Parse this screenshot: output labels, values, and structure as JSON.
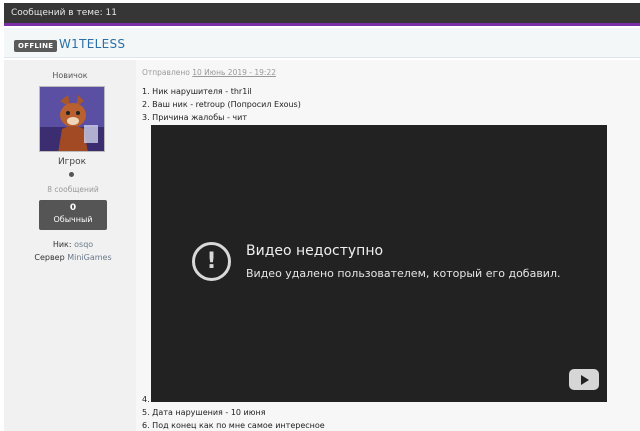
{
  "topbar": {
    "posts_in_topic": "Сообщений в теме: 11"
  },
  "post": {
    "status_badge": "OFFLINE",
    "author": "W1TELESS",
    "date_prefix": "Отправлено ",
    "date": "10 Июнь 2019 - 19:22",
    "lines": [
      "1. Ник нарушителя - thr1il",
      "2. Ваш ник - retroup (Попросил Exous)",
      "3. Причина жалобы - чит",
      "4.",
      "5. Дата нарушения - 10 июня",
      "6. Под конец как по мне самое интересное"
    ]
  },
  "user": {
    "rank_title": "Новичок",
    "group": "Игрок",
    "posts": "8 сообщений",
    "reputation_value": "0",
    "reputation_label": "Обычный",
    "nick_label": "Ник:",
    "nick_value": "osqo",
    "server_label": "Сервер",
    "server_value": "MiniGames"
  },
  "video": {
    "title": "Видео недоступно",
    "subtitle": "Видео удалено пользователем, который его добавил.",
    "warning_icon": "warning-circle-icon",
    "play_icon": "youtube-play-icon"
  }
}
